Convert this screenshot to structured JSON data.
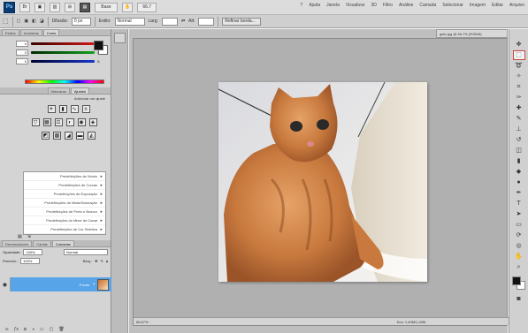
{
  "menubar": {
    "logo": "Ps",
    "home_label": "Base",
    "zoom": "66.7",
    "menu_items": [
      "?",
      "Ajuda",
      "Janela",
      "Visualizar",
      "3D",
      "Filtro",
      "Análise",
      "Camada",
      "Selecionar",
      "Imagem",
      "Editar",
      "Arquivo"
    ]
  },
  "options": {
    "feather_label": "Difusão:",
    "feather_value": "0 px",
    "style_label": "Estilo:",
    "style_value": "Normal",
    "refine_label": "Refinar borda...",
    "width_label": "Larg:",
    "height_label": "Alt:"
  },
  "color_panel": {
    "tabs": [
      "Cores",
      "Amostras",
      "Estilos"
    ],
    "sliders": [
      {
        "letter": "R",
        "value": "0",
        "color": "#d21717"
      },
      {
        "letter": "G",
        "value": "0",
        "color": "#14a020"
      },
      {
        "letter": "B",
        "value": "0",
        "color": "#1738c8"
      }
    ]
  },
  "adjustments": {
    "tabs": [
      "Ajustes",
      "Máscaras"
    ],
    "title": "Adicionar um ajuste",
    "presets": [
      "Predefinições de Níveis",
      "Predefinições de Curvas",
      "Predefinições de Exposição",
      "Predefinições de Matiz/Saturação",
      "Predefinições de Preto e Branco",
      "Predefinições do Mixer de Canal",
      "Predefinições de Cor Seletiva"
    ]
  },
  "layers": {
    "tabs": [
      "Camadas",
      "Canais",
      "Demarcadores"
    ],
    "blend_mode": "Normal",
    "opacity_label": "Opacidade:",
    "opacity_value": "100%",
    "lock_label": "Bloq.:",
    "fill_label": "Preench.:",
    "fill_value": "100%",
    "layer_name": "Fundo"
  },
  "document": {
    "tab_label": "gato.jpg @ 66,7% (RGB/8)",
    "zoom_status": "66,67%",
    "doc_info": "Doc: 1,40M/1,40M"
  }
}
